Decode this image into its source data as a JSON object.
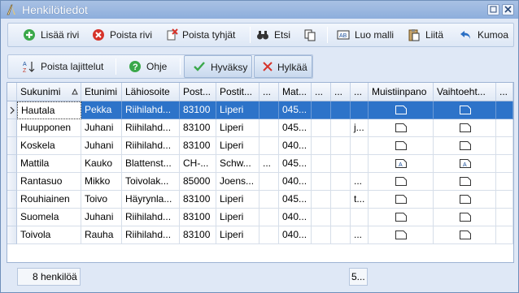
{
  "window": {
    "title": "Henkilötiedot"
  },
  "toolbar1": {
    "add_row": "Lisää rivi",
    "delete_row": "Poista rivi",
    "delete_empty": "Poista tyhjät",
    "search": "Etsi",
    "create_template": "Luo malli",
    "paste": "Liitä",
    "undo": "Kumoa"
  },
  "toolbar2": {
    "remove_sort": "Poista lajittelut",
    "help": "Ohje",
    "accept": "Hyväksy",
    "reject": "Hylkää"
  },
  "grid": {
    "columns": [
      "Sukunimi",
      "Etunimi",
      "Lähiosoite",
      "Post...",
      "Postit...",
      "...",
      "Mat...",
      "...",
      "...",
      "...",
      "Muistiinpano",
      "Vaihtoeht...",
      "..."
    ],
    "rows": [
      [
        "Hautala",
        "Pekka",
        "Riihilahd...",
        "83100",
        "Liperi",
        "",
        "045...",
        "",
        "",
        "",
        "",
        "",
        ""
      ],
      [
        "Huupponen",
        "Juhani",
        "Riihilahd...",
        "83100",
        "Liperi",
        "",
        "045...",
        "",
        "",
        "j...",
        "",
        "",
        ""
      ],
      [
        "Koskela",
        "Juhani",
        "Riihilahd...",
        "83100",
        "Liperi",
        "",
        "040...",
        "",
        "",
        "",
        "",
        "",
        ""
      ],
      [
        "Mattila",
        "Kauko",
        "Blattenst...",
        "CH-...",
        "Schw...",
        "...",
        "045...",
        "",
        "",
        "",
        "",
        "",
        ""
      ],
      [
        "Rantasuo",
        "Mikko",
        "Toivolak...",
        "85000",
        "Joens...",
        "",
        "040...",
        "",
        "",
        "...",
        "",
        "",
        ""
      ],
      [
        "Rouhiainen",
        "Toivo",
        "Häyrynla...",
        "83100",
        "Liperi",
        "",
        "045...",
        "",
        "",
        "t...",
        "",
        "",
        ""
      ],
      [
        "Suomela",
        "Juhani",
        "Riihilahd...",
        "83100",
        "Liperi",
        "",
        "040...",
        "",
        "",
        "",
        "",
        "",
        ""
      ],
      [
        "Toivola",
        "Rauha",
        "Riihilahd...",
        "83100",
        "Liperi",
        "",
        "040...",
        "",
        "",
        "...",
        "",
        "",
        ""
      ]
    ]
  },
  "footer": {
    "count": "8 henkilöä",
    "summary": "5..."
  }
}
